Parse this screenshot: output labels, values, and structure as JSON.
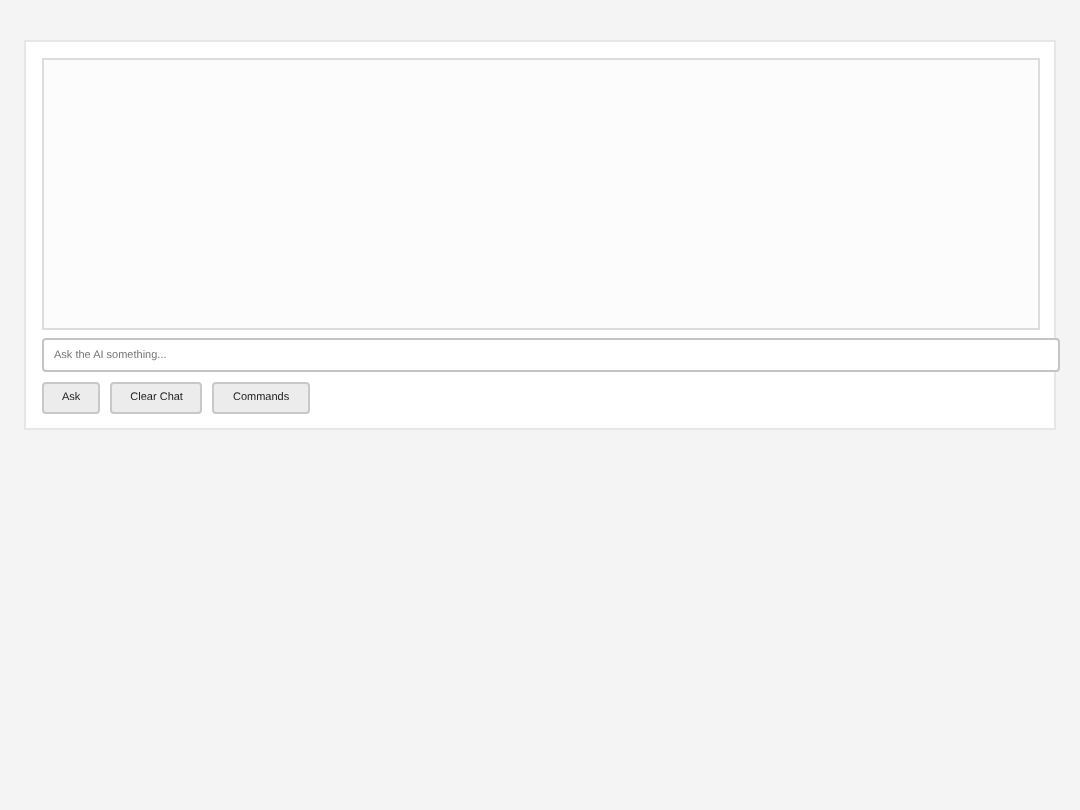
{
  "chat": {
    "placeholder": "Ask the AI something..."
  },
  "buttons": [
    {
      "label": "Ask"
    },
    {
      "label": "Clear Chat"
    },
    {
      "label": "Commands"
    }
  ]
}
